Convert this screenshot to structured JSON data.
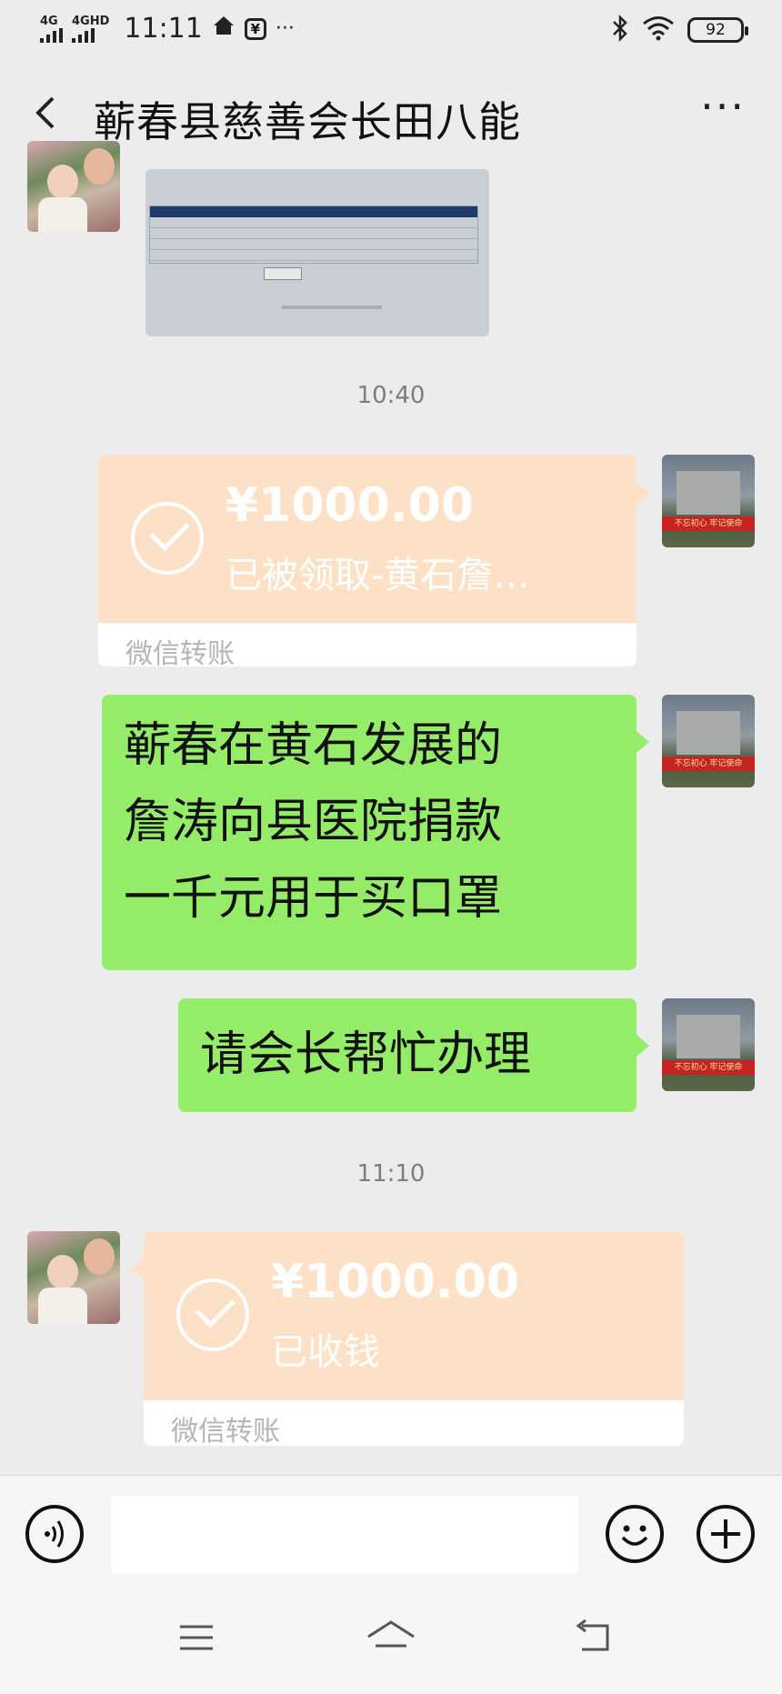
{
  "status_bar": {
    "net1": "4G",
    "net2": "4GHD",
    "time": "11:11",
    "pay_icon": "¥",
    "dots": "···",
    "battery": "92"
  },
  "header": {
    "back": "‹",
    "title": "蕲春县慈善会长田八能",
    "more": "···"
  },
  "messages": {
    "time_1": "10:40",
    "transfer_1": {
      "amount": "¥1000.00",
      "status": "已被领取-黄石詹…",
      "footer": "微信转账"
    },
    "text_1": [
      "蕲春在黄石发展的",
      "詹涛向县医院捐款",
      "一千元用于买口罩"
    ],
    "text_2": "请会长帮忙办理",
    "time_2": "11:10",
    "transfer_2": {
      "amount": "¥1000.00",
      "status": "已收钱",
      "footer": "微信转账"
    }
  },
  "avatar_banner": "不忘初心 牢记使命",
  "input_bar": {
    "voice": "voice-icon",
    "emoji": "emoji-icon",
    "plus": "plus-icon",
    "placeholder": ""
  },
  "nav": {
    "menu": "≡",
    "home": "⌂",
    "back": "↩"
  },
  "colors": {
    "transfer": "#fde1c6",
    "bubble": "#95ec69",
    "bg": "#ececec"
  }
}
